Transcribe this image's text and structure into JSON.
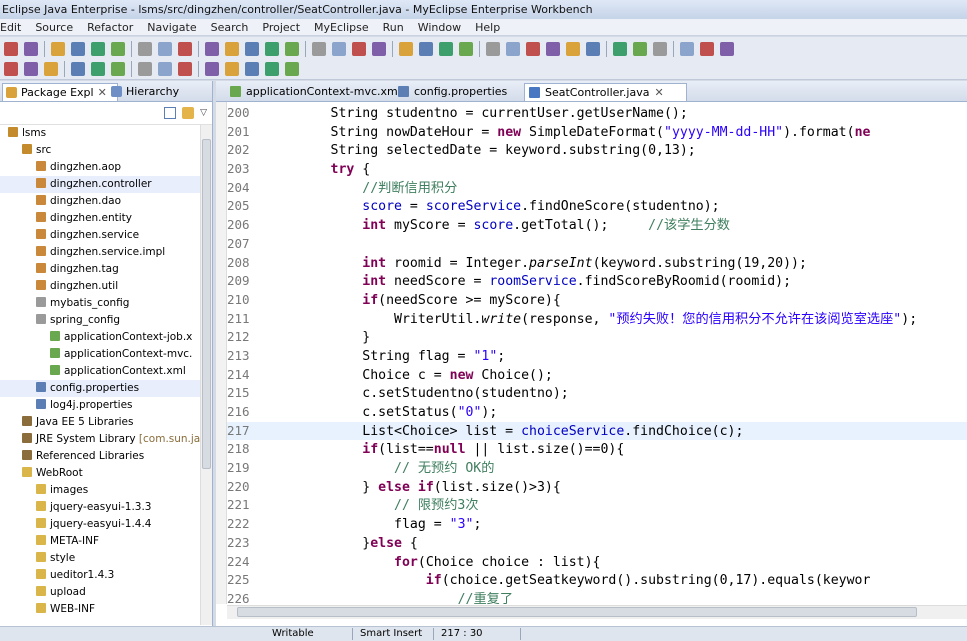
{
  "window": {
    "title": "Eclipse Java Enterprise - lsms/src/dingzhen/controller/SeatController.java - MyEclipse Enterprise Workbench"
  },
  "menu": [
    "Edit",
    "Source",
    "Refactor",
    "Navigate",
    "Search",
    "Project",
    "MyEclipse",
    "Run",
    "Window",
    "Help"
  ],
  "left_panel": {
    "tabs": [
      {
        "label": "Package Expl",
        "close": "✕"
      },
      {
        "label": "Hierarchy",
        "close": ""
      }
    ],
    "tree": [
      {
        "label": "lsms",
        "indent": 1,
        "icon": "project-icon",
        "color": "#c38b2b"
      },
      {
        "label": "src",
        "indent": 2,
        "icon": "source-folder-icon",
        "color": "#c38b2b"
      },
      {
        "label": "dingzhen.aop",
        "indent": 3,
        "icon": "package-icon",
        "color": "#c9883a"
      },
      {
        "label": "dingzhen.controller",
        "indent": 3,
        "icon": "package-icon",
        "color": "#c9883a",
        "selected": true
      },
      {
        "label": "dingzhen.dao",
        "indent": 3,
        "icon": "package-icon",
        "color": "#c9883a"
      },
      {
        "label": "dingzhen.entity",
        "indent": 3,
        "icon": "package-icon",
        "color": "#c9883a"
      },
      {
        "label": "dingzhen.service",
        "indent": 3,
        "icon": "package-icon",
        "color": "#c9883a"
      },
      {
        "label": "dingzhen.service.impl",
        "indent": 3,
        "icon": "package-icon",
        "color": "#c9883a"
      },
      {
        "label": "dingzhen.tag",
        "indent": 3,
        "icon": "package-icon",
        "color": "#c9883a"
      },
      {
        "label": "dingzhen.util",
        "indent": 3,
        "icon": "package-icon",
        "color": "#c9883a"
      },
      {
        "label": "mybatis_config",
        "indent": 3,
        "icon": "folder-package-icon",
        "color": "#9a9a9a"
      },
      {
        "label": "spring_config",
        "indent": 3,
        "icon": "folder-package-icon",
        "color": "#9a9a9a"
      },
      {
        "label": "applicationContext-job.x",
        "indent": 4,
        "icon": "xml-file-icon",
        "color": "#6aa84f"
      },
      {
        "label": "applicationContext-mvc.",
        "indent": 4,
        "icon": "xml-file-icon",
        "color": "#6aa84f"
      },
      {
        "label": "applicationContext.xml",
        "indent": 4,
        "icon": "xml-file-icon",
        "color": "#6aa84f"
      },
      {
        "label": "config.properties",
        "indent": 3,
        "icon": "properties-file-icon",
        "color": "#5b7fb5",
        "selected": true
      },
      {
        "label": "log4j.properties",
        "indent": 3,
        "icon": "properties-file-icon",
        "color": "#5b7fb5"
      },
      {
        "label": "Java EE 5 Libraries",
        "indent": 2,
        "icon": "library-icon",
        "color": "#8a6d3b"
      },
      {
        "label": "JRE System Library",
        "suffix": " [com.sun.jav",
        "indent": 2,
        "icon": "library-icon",
        "color": "#8a6d3b"
      },
      {
        "label": "Referenced Libraries",
        "indent": 2,
        "icon": "library-icon",
        "color": "#8a6d3b"
      },
      {
        "label": "WebRoot",
        "indent": 2,
        "icon": "folder-icon",
        "color": "#d9b54a"
      },
      {
        "label": "images",
        "indent": 3,
        "icon": "folder-icon",
        "color": "#d9b54a"
      },
      {
        "label": "jquery-easyui-1.3.3",
        "indent": 3,
        "icon": "folder-icon",
        "color": "#d9b54a"
      },
      {
        "label": "jquery-easyui-1.4.4",
        "indent": 3,
        "icon": "folder-icon",
        "color": "#d9b54a"
      },
      {
        "label": "META-INF",
        "indent": 3,
        "icon": "folder-icon",
        "color": "#d9b54a"
      },
      {
        "label": "style",
        "indent": 3,
        "icon": "folder-icon",
        "color": "#d9b54a"
      },
      {
        "label": "ueditor1.4.3",
        "indent": 3,
        "icon": "folder-icon",
        "color": "#d9b54a"
      },
      {
        "label": "upload",
        "indent": 3,
        "icon": "folder-icon",
        "color": "#d9b54a"
      },
      {
        "label": "WEB-INF",
        "indent": 3,
        "icon": "folder-icon",
        "color": "#d9b54a"
      }
    ]
  },
  "editor": {
    "tabs": [
      {
        "label": "applicationContext-mvc.xml",
        "icon": "xml-file-icon",
        "color": "#6aa84f"
      },
      {
        "label": "config.properties",
        "icon": "properties-file-icon",
        "color": "#5b7fb5"
      },
      {
        "label": "SeatController.java",
        "icon": "java-file-icon",
        "color": "#4a77c2",
        "active": true,
        "close": "✕"
      }
    ],
    "current_line": 217,
    "lines": [
      {
        "n": "200",
        "t": [
          [
            "        String studentno = currentUser.getUserName();",
            ""
          ]
        ]
      },
      {
        "n": "201",
        "t": [
          [
            "        String nowDateHour = ",
            ""
          ],
          [
            "new",
            "kw"
          ],
          [
            " SimpleDateFormat(",
            ""
          ],
          [
            "\"yyyy-MM-dd-HH\"",
            "str"
          ],
          [
            ").format(",
            ""
          ],
          [
            "ne",
            "kw"
          ]
        ]
      },
      {
        "n": "202",
        "t": [
          [
            "        String selectedDate = keyword.substring(0,13);",
            ""
          ]
        ]
      },
      {
        "n": "203",
        "t": [
          [
            "        ",
            ""
          ],
          [
            "try",
            "kw"
          ],
          [
            " {",
            ""
          ]
        ]
      },
      {
        "n": "204",
        "t": [
          [
            "            ",
            ""
          ],
          [
            "//判断信用积分",
            "cmt"
          ]
        ]
      },
      {
        "n": "205",
        "t": [
          [
            "            ",
            ""
          ],
          [
            "score",
            "fld"
          ],
          [
            " = ",
            ""
          ],
          [
            "scoreService",
            "fld"
          ],
          [
            ".findOneScore(studentno);",
            ""
          ]
        ]
      },
      {
        "n": "206",
        "t": [
          [
            "            ",
            ""
          ],
          [
            "int",
            "kw"
          ],
          [
            " myScore = ",
            ""
          ],
          [
            "score",
            "fld"
          ],
          [
            ".getTotal();     ",
            ""
          ],
          [
            "//该学生分数",
            "cmt"
          ]
        ]
      },
      {
        "n": "207",
        "t": [
          [
            "",
            ""
          ]
        ]
      },
      {
        "n": "208",
        "t": [
          [
            "            ",
            ""
          ],
          [
            "int",
            "kw"
          ],
          [
            " roomid = Integer.",
            ""
          ],
          [
            "parseInt",
            "it"
          ],
          [
            "(keyword.substring(19,20));",
            ""
          ]
        ]
      },
      {
        "n": "209",
        "t": [
          [
            "            ",
            ""
          ],
          [
            "int",
            "kw"
          ],
          [
            " needScore = ",
            ""
          ],
          [
            "roomService",
            "fld"
          ],
          [
            ".findScoreByRoomid(roomid);",
            ""
          ]
        ]
      },
      {
        "n": "210",
        "t": [
          [
            "            ",
            ""
          ],
          [
            "if",
            "kw"
          ],
          [
            "(needScore >= myScore){",
            ""
          ]
        ]
      },
      {
        "n": "211",
        "t": [
          [
            "                WriterUtil.",
            ""
          ],
          [
            "write",
            "it"
          ],
          [
            "(response, ",
            ""
          ],
          [
            "\"预约失败！您的信用积分不允许在该阅览室选座\"",
            "str"
          ],
          [
            ");",
            ""
          ]
        ]
      },
      {
        "n": "212",
        "t": [
          [
            "            }",
            ""
          ]
        ]
      },
      {
        "n": "213",
        "t": [
          [
            "            String flag = ",
            ""
          ],
          [
            "\"1\"",
            "str"
          ],
          [
            ";",
            ""
          ]
        ]
      },
      {
        "n": "214",
        "t": [
          [
            "            Choice c = ",
            ""
          ],
          [
            "new",
            "kw"
          ],
          [
            " Choice();",
            ""
          ]
        ]
      },
      {
        "n": "215",
        "t": [
          [
            "            c.setStudentno(studentno);",
            ""
          ]
        ]
      },
      {
        "n": "216",
        "t": [
          [
            "            c.setStatus(",
            ""
          ],
          [
            "\"0\"",
            "str"
          ],
          [
            ");",
            ""
          ]
        ]
      },
      {
        "n": "217",
        "t": [
          [
            "            List<Choice> list = ",
            ""
          ],
          [
            "choiceService",
            "fld"
          ],
          [
            ".findChoice(c);",
            ""
          ]
        ]
      },
      {
        "n": "218",
        "t": [
          [
            "            ",
            ""
          ],
          [
            "if",
            "kw"
          ],
          [
            "(list==",
            ""
          ],
          [
            "null",
            "kw"
          ],
          [
            " || list.size()==0){",
            ""
          ]
        ]
      },
      {
        "n": "219",
        "t": [
          [
            "                ",
            ""
          ],
          [
            "// 无预约 OK的",
            "cmt"
          ]
        ]
      },
      {
        "n": "220",
        "t": [
          [
            "            } ",
            ""
          ],
          [
            "else",
            "kw"
          ],
          [
            " ",
            ""
          ],
          [
            "if",
            "kw"
          ],
          [
            "(list.size()>3){",
            ""
          ]
        ]
      },
      {
        "n": "221",
        "t": [
          [
            "                ",
            ""
          ],
          [
            "// 限预约3次",
            "cmt"
          ]
        ]
      },
      {
        "n": "222",
        "t": [
          [
            "                flag = ",
            ""
          ],
          [
            "\"3\"",
            "str"
          ],
          [
            ";",
            ""
          ]
        ]
      },
      {
        "n": "223",
        "t": [
          [
            "            }",
            ""
          ],
          [
            "else",
            "kw"
          ],
          [
            " {",
            ""
          ]
        ]
      },
      {
        "n": "224",
        "t": [
          [
            "                ",
            ""
          ],
          [
            "for",
            "kw"
          ],
          [
            "(Choice choice : list){",
            ""
          ]
        ]
      },
      {
        "n": "225",
        "t": [
          [
            "                    ",
            ""
          ],
          [
            "if",
            "kw"
          ],
          [
            "(choice.getSeatkeyword().substring(0,17).equals(keywor",
            ""
          ]
        ]
      },
      {
        "n": "226",
        "t": [
          [
            "                        ",
            ""
          ],
          [
            "//重复了",
            "cmt"
          ]
        ]
      }
    ]
  },
  "status": {
    "mode": "Writable",
    "insert": "Smart Insert",
    "position": "217 : 30"
  }
}
